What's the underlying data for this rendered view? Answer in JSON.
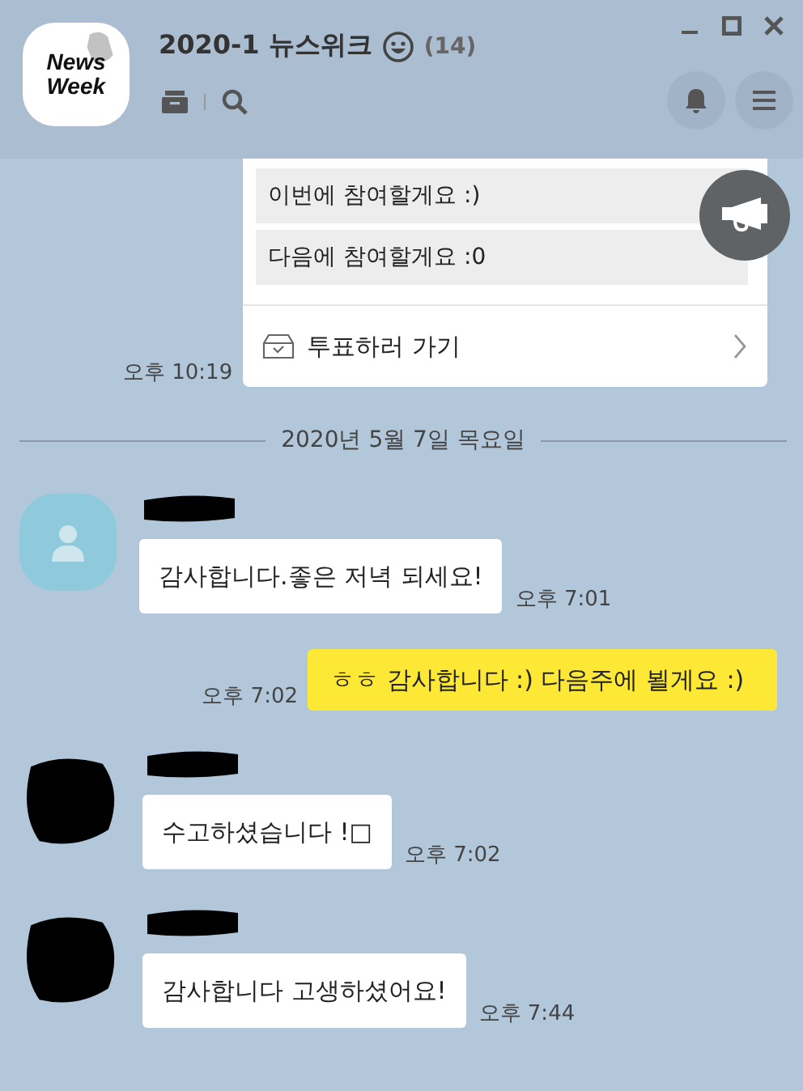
{
  "header": {
    "logo_text": [
      "News",
      "Week"
    ],
    "title": "2020-1 뉴스위크",
    "member_count": "(14)"
  },
  "poll": {
    "options": [
      {
        "label": "이번에 참여할게요 :)"
      },
      {
        "label": "다음에 참여할게요 :0"
      }
    ],
    "action": "투표하러 가기",
    "time": "오후 10:19"
  },
  "date_divider": "2020년 5월 7일 목요일",
  "messages": [
    {
      "kind": "received",
      "avatar": {
        "kind": "default"
      },
      "text": "감사합니다.좋은 저녁 되세요!",
      "time": "오후 7:01"
    },
    {
      "kind": "sent",
      "text": "ㅎㅎ 감사합니다 :) 다음주에 뵐게요 :)",
      "time": "오후 7:02"
    },
    {
      "kind": "received",
      "avatar": {
        "kind": "hidden"
      },
      "text": "수고하셨습니다 !□",
      "time": "오후 7:02"
    },
    {
      "kind": "received",
      "avatar": {
        "kind": "hidden"
      },
      "text": "감사합니다 고생하셨어요!",
      "time": "오후 7:44"
    }
  ]
}
